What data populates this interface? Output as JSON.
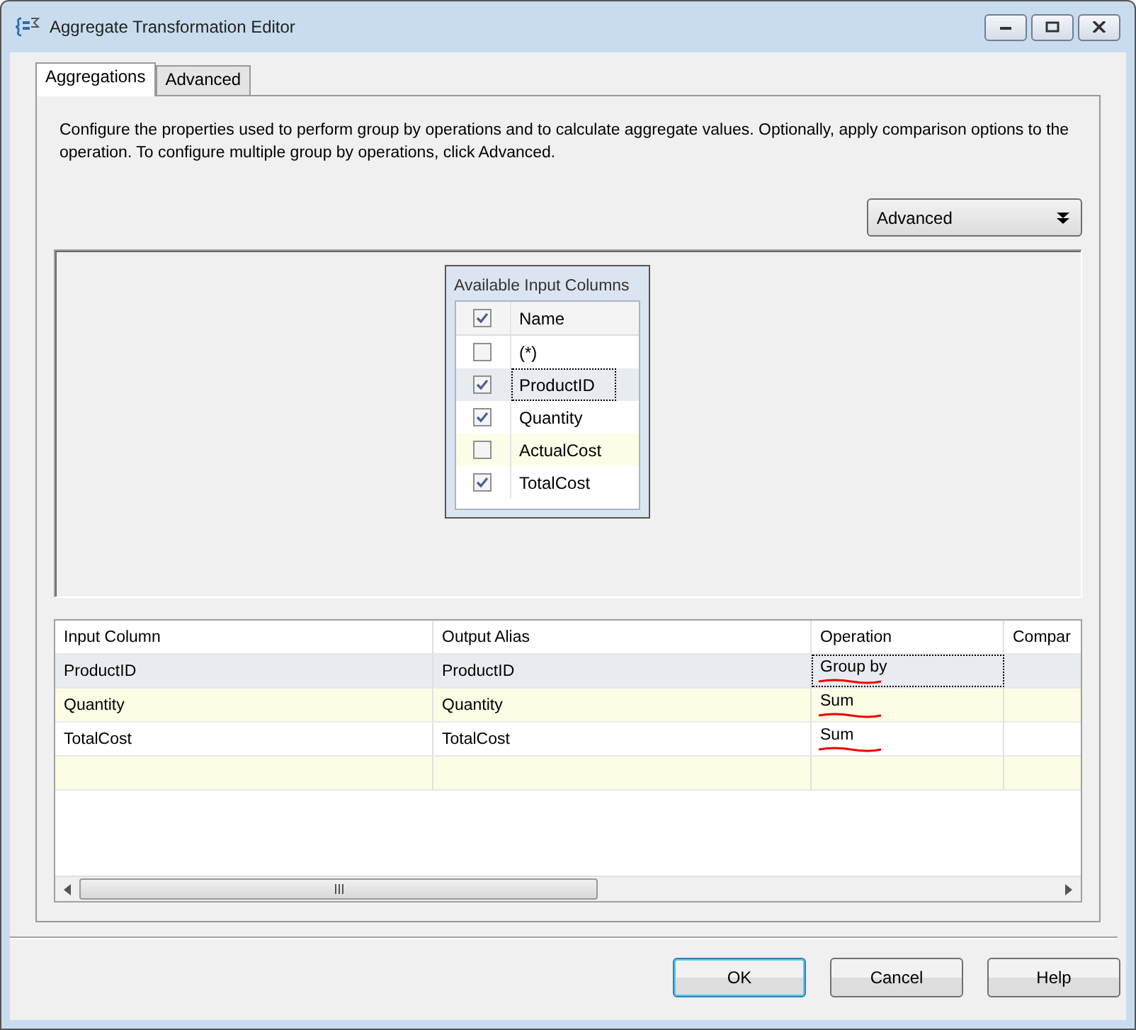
{
  "window": {
    "title": "Aggregate Transformation Editor"
  },
  "tabs": [
    {
      "label": "Aggregations",
      "selected": true
    },
    {
      "label": "Advanced",
      "selected": false
    }
  ],
  "description": "Configure the properties used to perform group by operations and to calculate aggregate values. Optionally, apply comparison options to the operation. To configure multiple group by operations, click Advanced.",
  "advanced_button": {
    "label": "Advanced"
  },
  "input_columns": {
    "title": "Available Input Columns",
    "header": "Name",
    "header_checked": true,
    "items": [
      {
        "name": "(*)",
        "checked": false,
        "selected": false,
        "highlighted": false
      },
      {
        "name": "ProductID",
        "checked": true,
        "selected": true,
        "highlighted": false
      },
      {
        "name": "Quantity",
        "checked": true,
        "selected": false,
        "highlighted": false
      },
      {
        "name": "ActualCost",
        "checked": false,
        "selected": false,
        "highlighted": true
      },
      {
        "name": "TotalCost",
        "checked": true,
        "selected": false,
        "highlighted": false
      }
    ]
  },
  "grid": {
    "columns": [
      "Input Column",
      "Output Alias",
      "Operation",
      "Compar"
    ],
    "rows": [
      {
        "input_column": "ProductID",
        "output_alias": "ProductID",
        "operation": "Group by",
        "selected": true,
        "annotated": true
      },
      {
        "input_column": "Quantity",
        "output_alias": "Quantity",
        "operation": "Sum",
        "selected": false,
        "annotated": true
      },
      {
        "input_column": "TotalCost",
        "output_alias": "TotalCost",
        "operation": "Sum",
        "selected": false,
        "annotated": true
      },
      {
        "input_column": "",
        "output_alias": "",
        "operation": "",
        "selected": false
      }
    ]
  },
  "buttons": [
    {
      "label": "OK",
      "default": true
    },
    {
      "label": "Cancel",
      "default": false
    },
    {
      "label": "Help",
      "default": false
    }
  ]
}
